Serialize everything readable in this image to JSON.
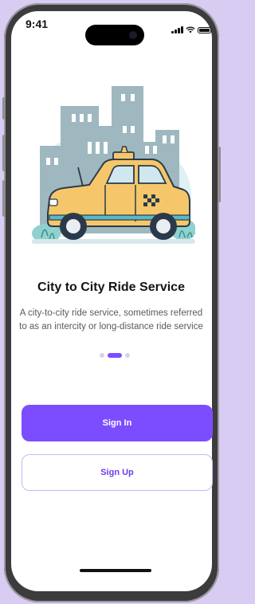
{
  "status_bar": {
    "time": "9:41"
  },
  "onboarding": {
    "title": "City to City Ride Service",
    "description": "A city-to-city ride service, sometimes referred to as an intercity or long-distance ride service",
    "page_indicator": {
      "total": 3,
      "active": 2
    }
  },
  "actions": {
    "sign_in_label": "Sign In",
    "sign_up_label": "Sign Up"
  },
  "colors": {
    "accent": "#7c4dff",
    "taxi": "#f5c76a",
    "buildings": "#9fb8bf"
  },
  "icons": [
    "signal-icon",
    "wifi-icon",
    "battery-icon",
    "taxi-illustration"
  ]
}
